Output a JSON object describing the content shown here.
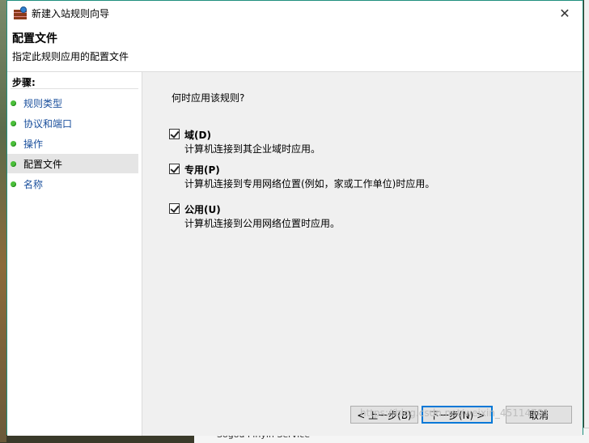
{
  "window": {
    "title": "新建入站规则向导"
  },
  "header": {
    "title": "配置文件",
    "subtitle": "指定此规则应用的配置文件"
  },
  "sidebar": {
    "title": "步骤:",
    "items": [
      {
        "label": "规则类型"
      },
      {
        "label": "协议和端口"
      },
      {
        "label": "操作"
      },
      {
        "label": "配置文件",
        "selected": true
      },
      {
        "label": "名称"
      }
    ]
  },
  "main": {
    "question": "何时应用该规则?",
    "options": [
      {
        "label": "域(D)",
        "desc": "计算机连接到其企业域时应用。",
        "checked": true
      },
      {
        "label": "专用(P)",
        "desc": "计算机连接到专用网络位置(例如，家或工作单位)时应用。",
        "checked": true
      },
      {
        "label": "公用(U)",
        "desc": "计算机连接到公用网络位置时应用。",
        "checked": true
      }
    ]
  },
  "buttons": {
    "back": "< 上一步(B)",
    "next": "下一步(N) >",
    "cancel": "取消"
  },
  "watermark": "https://blog.csdn.net/weixin_45114701",
  "background": {
    "bottom_text": "Sogou Pinyin Service"
  }
}
